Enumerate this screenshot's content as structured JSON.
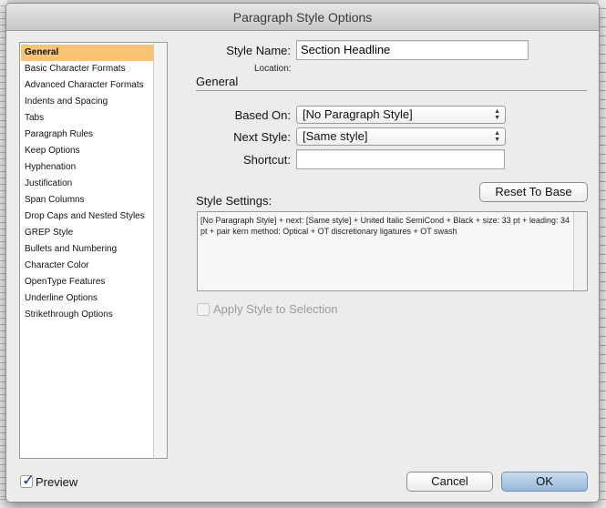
{
  "dialog": {
    "title": "Paragraph Style Options"
  },
  "sidebar": {
    "items": [
      {
        "label": "General",
        "selected": true
      },
      {
        "label": "Basic Character Formats"
      },
      {
        "label": "Advanced Character Formats"
      },
      {
        "label": "Indents and Spacing"
      },
      {
        "label": "Tabs"
      },
      {
        "label": "Paragraph Rules"
      },
      {
        "label": "Keep Options"
      },
      {
        "label": "Hyphenation"
      },
      {
        "label": "Justification"
      },
      {
        "label": "Span Columns"
      },
      {
        "label": "Drop Caps and Nested Styles"
      },
      {
        "label": "GREP Style"
      },
      {
        "label": "Bullets and Numbering"
      },
      {
        "label": "Character Color"
      },
      {
        "label": "OpenType Features"
      },
      {
        "label": "Underline Options"
      },
      {
        "label": "Strikethrough Options"
      }
    ]
  },
  "form": {
    "style_name_label": "Style Name:",
    "style_name_value": "Section Headline",
    "location_label": "Location:",
    "section_title": "General",
    "based_on_label": "Based On:",
    "based_on_value": "[No Paragraph Style]",
    "next_style_label": "Next Style:",
    "next_style_value": "[Same style]",
    "shortcut_label": "Shortcut:",
    "shortcut_value": "",
    "style_settings_label": "Style Settings:",
    "reset_button": "Reset To Base",
    "style_settings_text": "[No Paragraph Style] + next: [Same style] + United Italic SemiCond + Black + size: 33 pt + leading: 34 pt + pair kern method: Optical + OT discretionary ligatures + OT swash",
    "apply_style_label": "Apply Style to Selection"
  },
  "footer": {
    "preview_label": "Preview",
    "preview_checked": true,
    "cancel_button": "Cancel",
    "ok_button": "OK"
  },
  "colors": {
    "selection": "#f9c574",
    "default_button": "#98b8da"
  },
  "icons": {
    "select_arrows": "up-down-arrows-icon",
    "checkmark": "checkmark-icon"
  }
}
